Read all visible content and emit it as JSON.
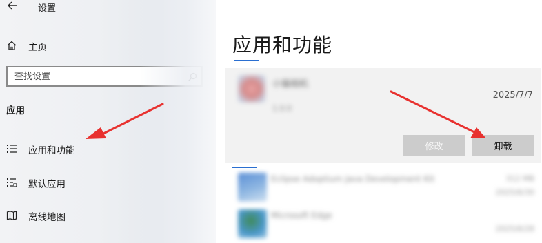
{
  "window": {
    "title": "设置",
    "back_icon": "back-arrow-icon"
  },
  "sidebar": {
    "home": {
      "label": "主页",
      "icon": "home-icon"
    },
    "search": {
      "placeholder": "查找设置",
      "value": "",
      "icon": "search-icon"
    },
    "section_label": "应用",
    "items": [
      {
        "label": "应用和功能",
        "icon": "apps-features-icon"
      },
      {
        "label": "默认应用",
        "icon": "default-apps-icon"
      },
      {
        "label": "离线地图",
        "icon": "offline-maps-icon"
      }
    ]
  },
  "main": {
    "title": "应用和功能",
    "selected_app": {
      "name": "小猫相机",
      "publisher": "1.0.0",
      "install_date": "2025/7/7",
      "modify_label": "修改",
      "uninstall_label": "卸载"
    },
    "apps": [
      {
        "name": "Eclipse Adoptium Java Development Kit",
        "size": "312 MB",
        "date": "2025/6/30"
      },
      {
        "name": "Microsoft Edge",
        "size": "",
        "date": "2025/6/28"
      }
    ]
  },
  "colors": {
    "accent": "#2a6fd1",
    "annotation_arrow": "#e8312f",
    "button_bg": "#cccccc",
    "card_bg": "#f2f2f2"
  }
}
